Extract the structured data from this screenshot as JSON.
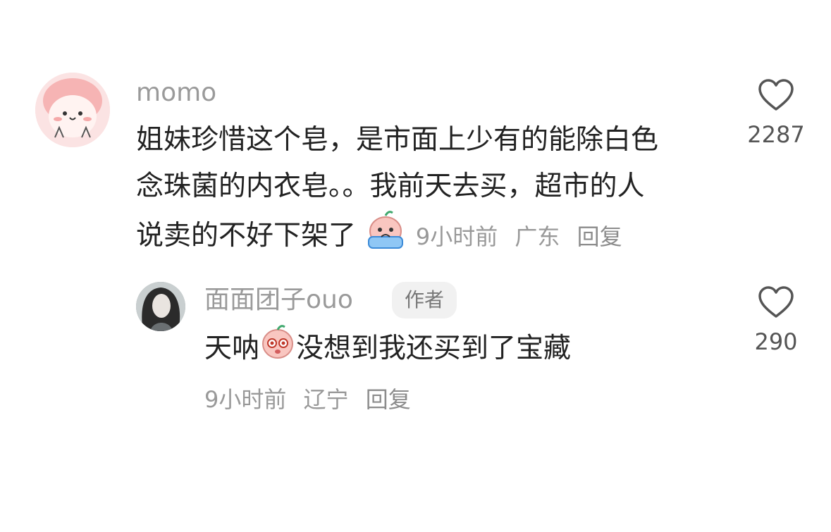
{
  "comment": {
    "username": "momo",
    "lines": [
      "姐妹珍惜这个皂，是市面上少有的能除白色",
      "念珠菌的内衣皂。。我前天去买，超市的人",
      "说卖的不好下架了"
    ],
    "emoji_icon": "crying-face-emoji",
    "time": "9小时前",
    "location": "广东",
    "reply_label": "回复",
    "like_count": "2287"
  },
  "reply": {
    "username": "面面团子ouo",
    "badge": "作者",
    "text_before": "天呐",
    "emoji_icon": "starry-eyed-face-emoji",
    "text_after": "没想到我还买到了宝藏",
    "time": "9小时前",
    "location": "辽宁",
    "reply_label": "回复",
    "like_count": "290"
  }
}
